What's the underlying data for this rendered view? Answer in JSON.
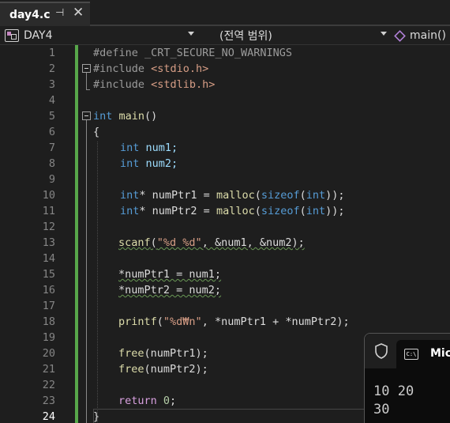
{
  "tab": {
    "title": "day4.c",
    "pin_glyph": "⊣",
    "close_glyph": "✕"
  },
  "navbar": {
    "project": "DAY4",
    "scope": "(전역 범위)",
    "function": "main()"
  },
  "editor": {
    "line_numbers": [
      "1",
      "2",
      "3",
      "4",
      "5",
      "6",
      "7",
      "8",
      "9",
      "10",
      "11",
      "12",
      "13",
      "14",
      "15",
      "16",
      "17",
      "18",
      "19",
      "20",
      "21",
      "22",
      "23",
      "24"
    ],
    "current_line": "24",
    "lines": {
      "l1": {
        "directive": "#define",
        "macro": " _CRT_SECURE_NO_WARNINGS"
      },
      "l2": {
        "directive": "#include",
        "header": " <stdio.h>"
      },
      "l3": {
        "directive": "#include",
        "header": " <stdlib.h>"
      },
      "l5": {
        "type": "int",
        "name": " main",
        "rest": "()"
      },
      "l6": {
        "text": "{"
      },
      "l7": {
        "type": "int",
        "rest": " num1;"
      },
      "l8": {
        "type": "int",
        "rest": " num2;"
      },
      "l10": {
        "type": "int",
        "decl": "* numPtr1 = ",
        "call": "malloc",
        "open": "(",
        "op": "sizeof",
        "paren": "(",
        "argtype": "int",
        "close": "));"
      },
      "l11": {
        "type": "int",
        "decl": "* numPtr2 = ",
        "call": "malloc",
        "open": "(",
        "op": "sizeof",
        "paren": "(",
        "argtype": "int",
        "close": "));"
      },
      "l13": {
        "call": "scanf",
        "open": "(",
        "fmt": "\"%d %d\"",
        "args": ", &num1, &num2);"
      },
      "l15": {
        "text": "*numPtr1 = num1;"
      },
      "l16": {
        "text": "*numPtr2 = num2;"
      },
      "l18": {
        "call": "printf",
        "open": "(",
        "fmt": "\"%d₩n\"",
        "args": ", *numPtr1 + *numPtr2);"
      },
      "l20": {
        "call": "free",
        "args": "(numPtr1);"
      },
      "l21": {
        "call": "free",
        "args": "(numPtr2);"
      },
      "l23": {
        "keyword": "return",
        "value": " 0",
        "end": ";"
      },
      "l24": {
        "text": "}"
      }
    }
  },
  "terminal": {
    "title": "Mic",
    "cmd_icon_text": "C:\\",
    "output": "10 20\n30"
  },
  "colors": {
    "keyword": "#569cd6",
    "control": "#d8a0df",
    "function": "#dcdcaa",
    "string": "#d69d85",
    "number": "#b5cea8",
    "change_bar": "#57a64a"
  }
}
